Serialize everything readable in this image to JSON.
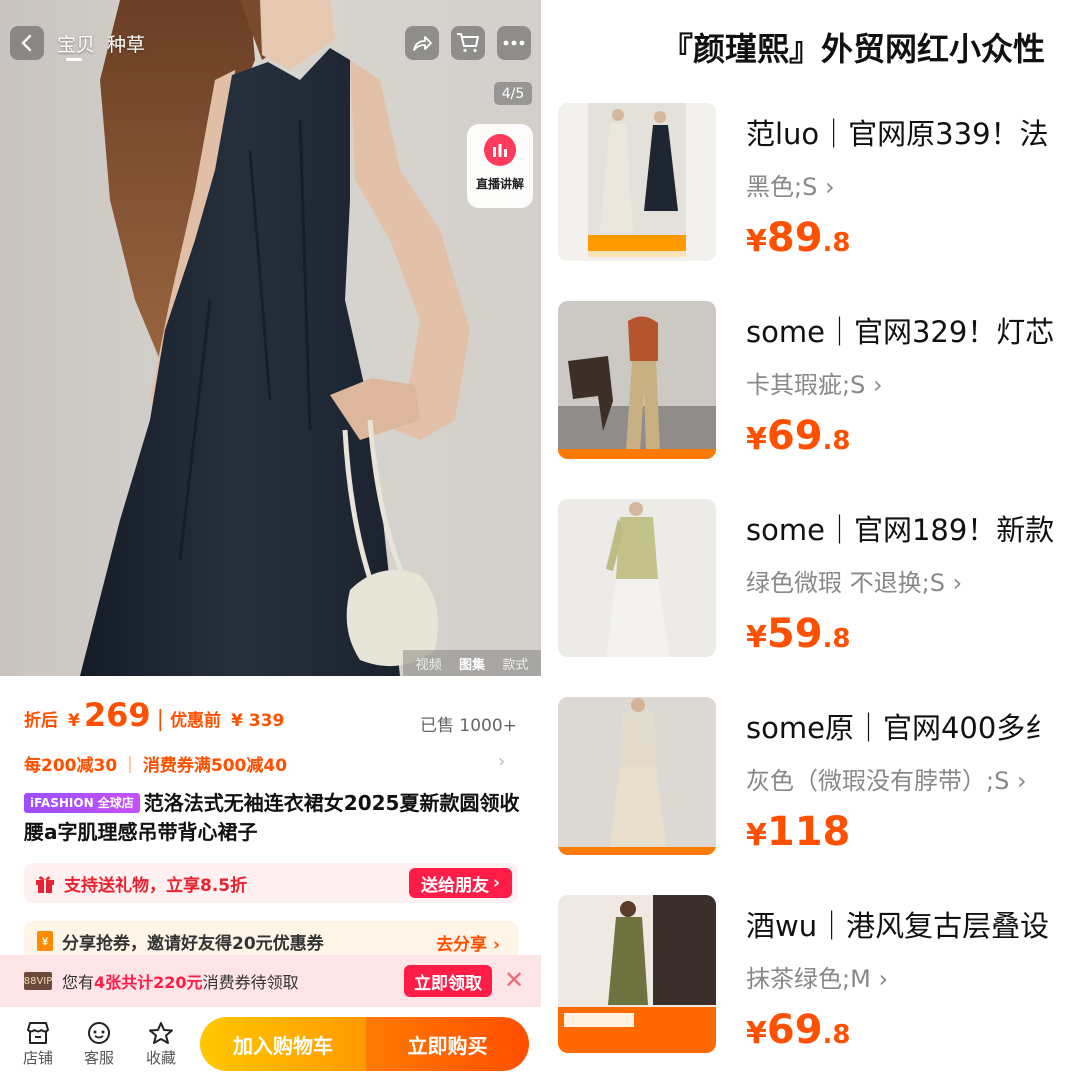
{
  "top_nav": {
    "tabs": [
      {
        "label": "宝贝",
        "active": true
      },
      {
        "label": "种草",
        "active": false
      }
    ],
    "icons": [
      "back-icon",
      "share-icon",
      "cart-icon",
      "more-icon"
    ]
  },
  "gallery": {
    "counter": "4/5",
    "live_label": "直播讲解",
    "modes": [
      {
        "label": "视频"
      },
      {
        "label": "图集",
        "active": true
      },
      {
        "label": "款式"
      }
    ]
  },
  "price": {
    "label": "折后",
    "currency": "¥",
    "value": "269",
    "separator": "|",
    "prev_label": "优惠前",
    "prev_value": "¥ 339",
    "sold": "已售 1000+"
  },
  "promos": [
    "每200减30",
    "消费券满500减40"
  ],
  "promo_sep": "|",
  "product": {
    "badge": "iFASHION 全球店",
    "title": "范洛法式无袖连衣裙女2025夏新款圆领收腰a字肌理感吊带背心裙子"
  },
  "gift_bar": {
    "text": "支持送礼物，立享8.5折",
    "button": "送给朋友"
  },
  "share_bar": {
    "text": "分享抢券，邀请好友得20元优惠券",
    "link": "去分享"
  },
  "coupon_bar": {
    "badge": "88VIP",
    "text_before": "您有",
    "highlight": "4张共计220元",
    "text_after": "消费券待领取",
    "button": "立即领取"
  },
  "bottom_bar": {
    "store": "店铺",
    "service": "客服",
    "favorite": "收藏",
    "add_to_cart": "加入购物车",
    "buy_now": "立即购买"
  },
  "store_title": "『颜瑾熙』外贸网红小众性",
  "items": [
    {
      "title": "范luo｜官网原339！法",
      "variant": "黑色;S",
      "price_int": "89",
      "price_dec": ".8"
    },
    {
      "title": "some｜官网329！灯芯",
      "variant": "卡其瑕疵;S",
      "price_int": "69",
      "price_dec": ".8"
    },
    {
      "title": "some｜官网189！新款",
      "variant": "绿色微瑕 不退换;S",
      "price_int": "59",
      "price_dec": ".8"
    },
    {
      "title": "some原｜官网400多纟",
      "variant": "灰色（微瑕没有脖带）;S",
      "price_int": "118",
      "price_dec": ""
    },
    {
      "title": "酒wu｜港风复古层叠设",
      "variant": "抹茶绿色;M",
      "price_int": "69",
      "price_dec": ".8"
    }
  ],
  "currency": "¥",
  "colors": {
    "accent": "#ff5000",
    "red": "#ff1d48",
    "dress": "#1f2a38"
  }
}
